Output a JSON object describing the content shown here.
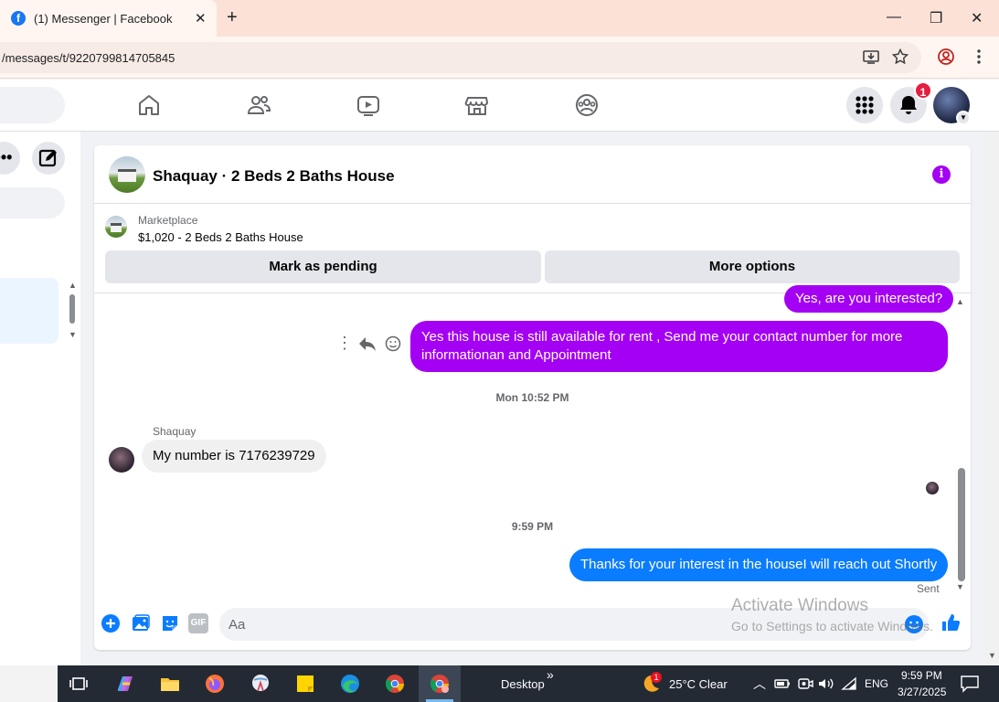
{
  "browser": {
    "tab_title": "(1) Messenger | Facebook",
    "favicon_letter": "f",
    "url": "/messages/t/9220799814705845"
  },
  "facebook": {
    "notification_count": "1"
  },
  "sidebar": {
    "more_label": "•••"
  },
  "chat": {
    "title": "Shaquay · 2 Beds 2 Baths House",
    "marketplace_label": "Marketplace",
    "listing": "$1,020 - 2 Beds 2 Baths House",
    "mark_pending_label": "Mark as pending",
    "more_options_label": "More options",
    "messages": [
      {
        "from": "me",
        "text": "Yes, are you interested?"
      },
      {
        "from": "me",
        "text": "Yes this house is still available for rent , Send me your contact number for more informationan and Appointment"
      },
      {
        "from": "them",
        "sender": "Shaquay",
        "text": "My number is 7176239729"
      },
      {
        "from": "me",
        "text": "Thanks for your interest in the houseI will reach out Shortly"
      }
    ],
    "timestamps": [
      "Mon 10:52 PM",
      "9:59 PM"
    ],
    "sent_status": "Sent",
    "composer_placeholder": "Aa",
    "gif_label": "GIF"
  },
  "watermark": {
    "line1": "Activate Windows",
    "line2": "Go to Settings to activate Windows."
  },
  "taskbar": {
    "desktop_label": "Desktop",
    "chevron": "»",
    "weather": "25°C  Clear",
    "weather_badge": "1",
    "language": "ENG",
    "time": "9:59 PM",
    "date": "3/27/2025"
  },
  "colors": {
    "purple_bubble": "#a400f3",
    "blue_bubble": "#0a7cff",
    "facebook_blue": "#1877f2",
    "badge_red": "#e41e3f"
  }
}
